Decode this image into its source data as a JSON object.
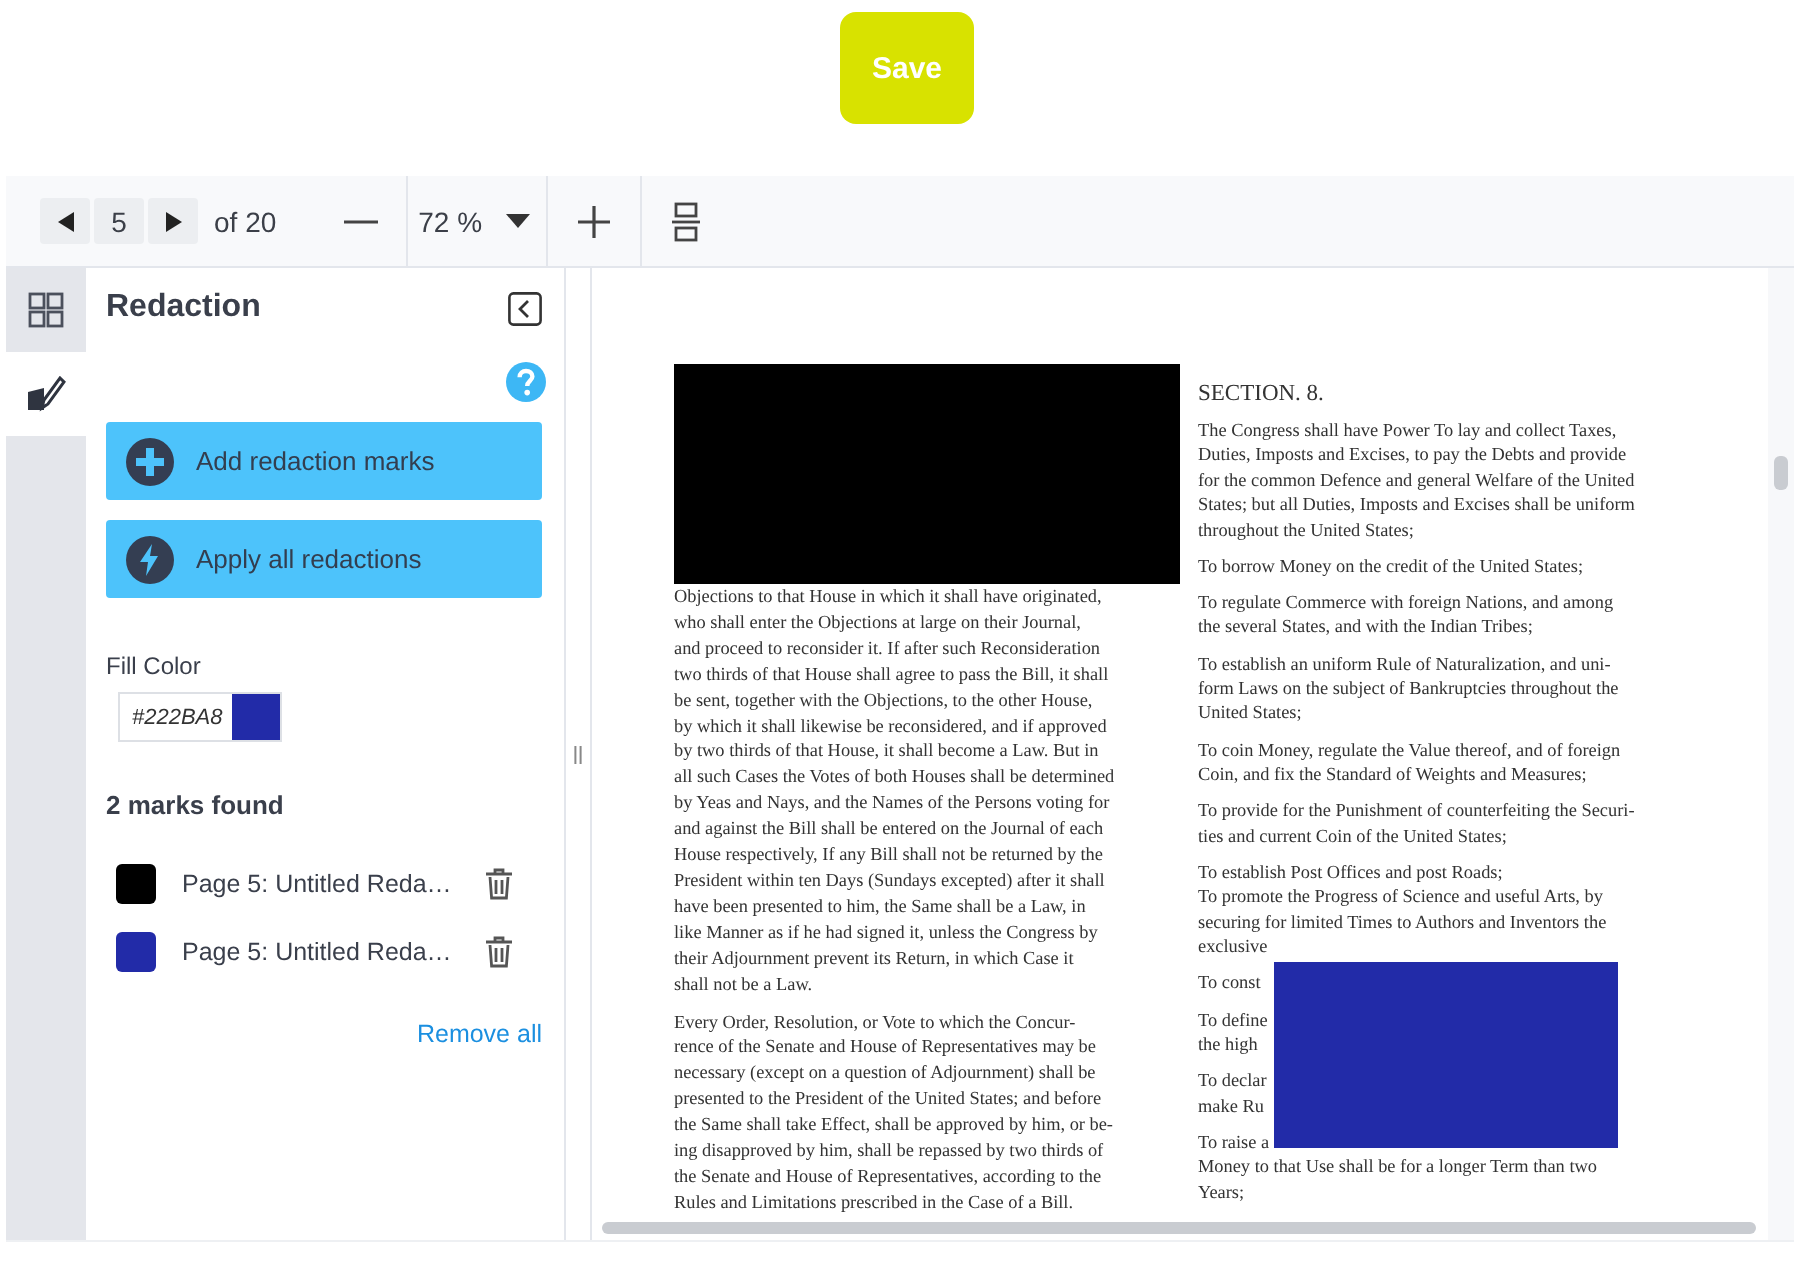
{
  "save_button": {
    "label": "Save"
  },
  "toolbar": {
    "page": "5",
    "page_count": "of 20",
    "zoom": "72 %"
  },
  "sidebar_tabs": [
    {
      "kind": "thumbnails",
      "selected": false
    },
    {
      "kind": "redaction",
      "selected": true
    }
  ],
  "panel": {
    "title": "Redaction",
    "actions": [
      {
        "kind": "add",
        "label": "Add redaction marks"
      },
      {
        "kind": "apply",
        "label": "Apply all redactions"
      }
    ],
    "fill_color": {
      "label": "Fill Color",
      "value": "#222BA8",
      "color": "#222ba8"
    },
    "marks_count": "2 marks found",
    "marks": [
      {
        "label": "Page 5: Untitled Reda…",
        "color": "#000000"
      },
      {
        "label": "Page 5: Untitled Reda…",
        "color": "#222ba8"
      }
    ],
    "remove_all": "Remove all"
  },
  "document": {
    "left_column": [
      [
        "Objections to that House in which it shall have originated,",
        "who shall enter the Objections at large on their Journal,",
        "and proceed to reconsider it. If after such Reconsideration",
        "two thirds of that House shall agree to pass the Bill, it shall",
        "be sent, together with the Objections, to the other House,",
        "by which it shall likewise be reconsidered, and if approved",
        "by two thirds of that House, it shall become a Law. But in",
        "all such Cases the Votes of both Houses shall be determined",
        "by Yeas and Nays, and the Names of the Persons voting for",
        "and against the Bill shall be entered on the Journal of each",
        "House respectively, If any Bill shall not be returned by the",
        "President within ten Days (Sundays excepted) after it shall",
        "have been presented to him, the Same shall be a Law, in",
        "like Manner as if he had signed it, unless the Congress by",
        "their Adjournment prevent its Return, in which Case it",
        "shall not be a Law."
      ],
      [
        "Every Order, Resolution, or Vote to which the Concur-",
        "rence of the Senate and House of Representatives may be",
        "necessary (except on a question of Adjournment) shall be",
        "presented to the President of the United States; and before",
        "the Same shall take Effect, shall be approved by him, or be-",
        "ing disapproved by him, shall be repassed by two thirds of",
        "the Senate and House of Representatives, according to the",
        "Rules and Limitations prescribed in the Case of a Bill."
      ]
    ],
    "heading": "SECTION. 8.",
    "right_column": [
      [
        "The Congress shall have Power To lay and collect Taxes,",
        "Duties, Imposts and Excises, to pay the Debts and provide",
        "for the common Defence and general Welfare of the United",
        "States; but all Duties, Imposts and Excises shall be uniform",
        "throughout the United States;"
      ],
      [
        "To borrow Money on the credit of the United States;"
      ],
      [
        "To regulate Commerce with foreign Nations, and among",
        "the several States, and with the Indian Tribes;"
      ],
      [
        "To establish an uniform Rule of Naturalization, and uni-",
        "form Laws on the subject of Bankruptcies throughout the",
        "United States;"
      ],
      [
        "To coin Money, regulate the Value thereof, and of foreign",
        "Coin, and fix the Standard of Weights and Measures;"
      ],
      [
        "To provide for the Punishment of counterfeiting the Securi-",
        "ties and current Coin of the United States;"
      ],
      [
        "To establish Post Offices and post Roads;",
        "To promote the Progress of Science and useful Arts, by",
        "securing for limited Times to Authors and Inventors the",
        "exclusive"
      ],
      [
        "To const"
      ],
      [
        "To define",
        "the high"
      ],
      [
        "To declar",
        "make Ru"
      ],
      [
        "To raise a",
        "Money to that Use shall be for a longer Term than two",
        "Years;"
      ]
    ],
    "redactions": [
      {
        "color": "#000000"
      },
      {
        "color": "#222ba8"
      }
    ]
  }
}
